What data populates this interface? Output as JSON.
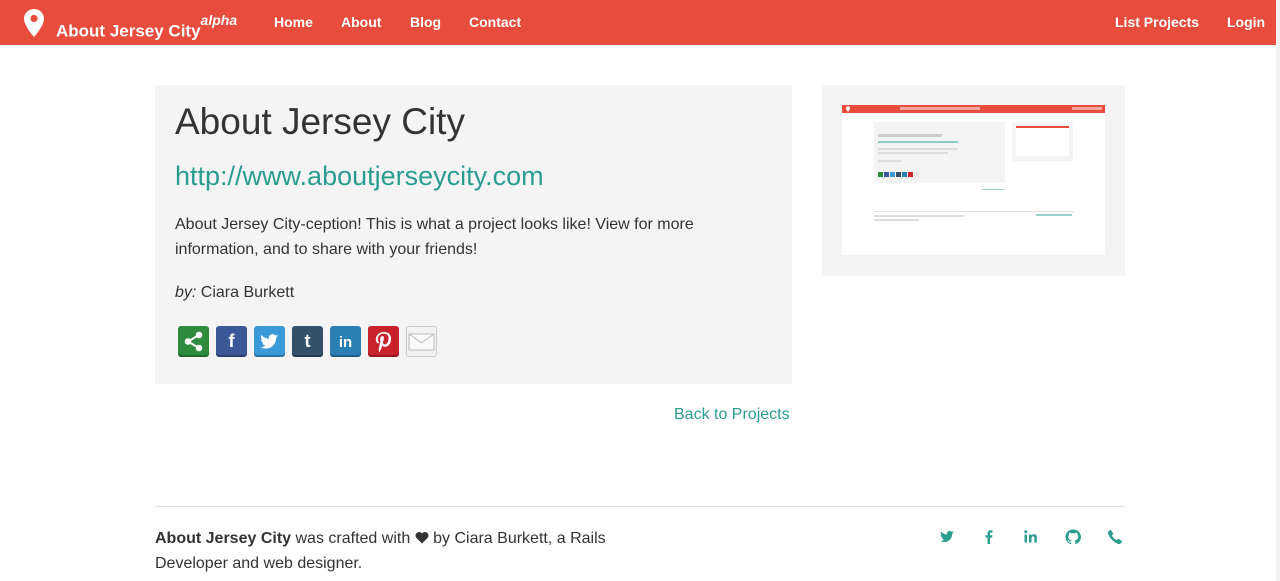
{
  "nav": {
    "brand": "About Jersey City",
    "brand_badge": "alpha",
    "links": [
      "Home",
      "About",
      "Blog",
      "Contact"
    ],
    "right_links": [
      "List Projects",
      "Login"
    ]
  },
  "project": {
    "title": "About Jersey City",
    "url": "http://www.aboutjerseycity.com",
    "description": "About Jersey City-ception! This is what a project looks like! View for more information, and to share with your friends!",
    "by_label": "by:",
    "author": "Ciara Burkett",
    "share_icons": [
      "share-icon",
      "facebook-icon",
      "twitter-icon",
      "tumblr-icon",
      "linkedin-icon",
      "pinterest-icon",
      "email-icon"
    ]
  },
  "back_link": "Back to Projects",
  "footer": {
    "site_name": "About Jersey City",
    "crafted_text": "was crafted with",
    "credit": "by Ciara Burkett, a Rails Developer and web designer.",
    "social_icons": [
      "twitter-icon",
      "facebook-icon",
      "linkedin-icon",
      "github-icon",
      "phone-icon"
    ]
  },
  "colors": {
    "brand": "#e74c3c",
    "accent": "#2a9d8f",
    "card_bg": "#f4f4f4"
  }
}
